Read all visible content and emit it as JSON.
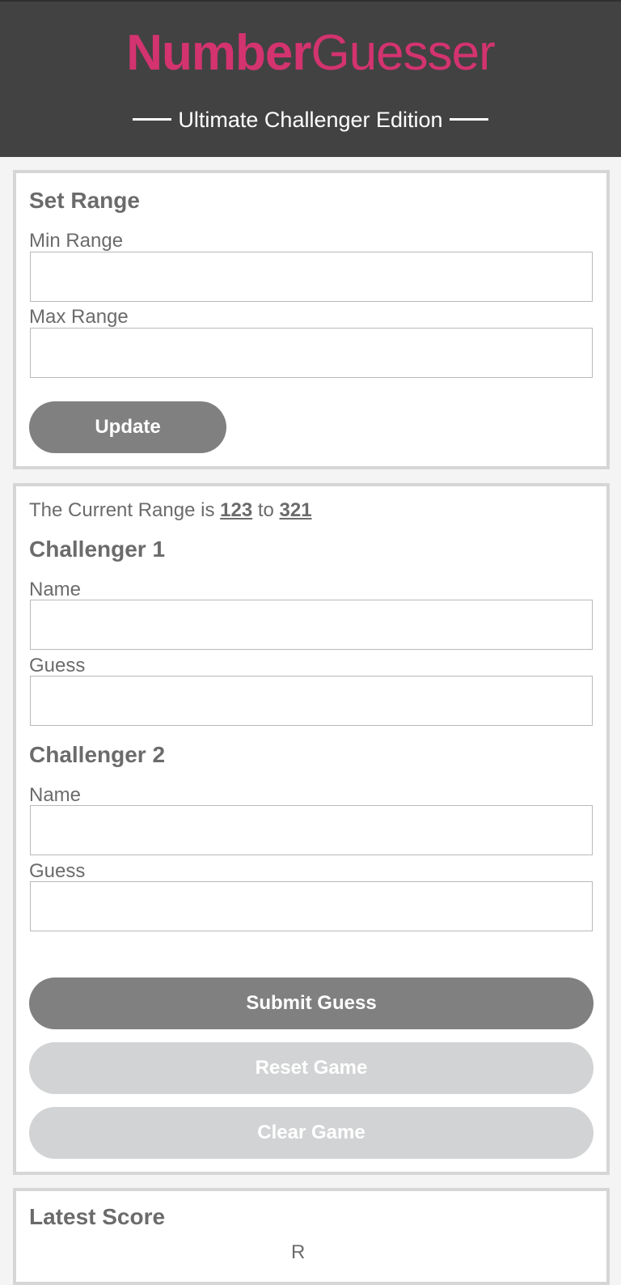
{
  "header": {
    "logo_bold": "Number",
    "logo_light": "Guesser",
    "subtitle": "Ultimate Challenger Edition"
  },
  "set_range": {
    "title": "Set Range",
    "min_label": "Min Range",
    "min_value": "",
    "max_label": "Max Range",
    "max_value": "",
    "update_button": "Update"
  },
  "challenge": {
    "range_prefix": "The Current Range is",
    "range_min": "123",
    "range_joiner": "to",
    "range_max": "321",
    "challenger1": {
      "title": "Challenger 1",
      "name_label": "Name",
      "name_value": "",
      "guess_label": "Guess",
      "guess_value": ""
    },
    "challenger2": {
      "title": "Challenger 2",
      "name_label": "Name",
      "name_value": "",
      "guess_label": "Guess",
      "guess_value": ""
    },
    "submit_button": "Submit Guess",
    "reset_button": "Reset Game",
    "clear_button": "Clear Game"
  },
  "score": {
    "title": "Latest Score",
    "partial_text": "R"
  },
  "colors": {
    "header_bg": "#424242",
    "logo": "#d3336f",
    "button_dark": "#808080",
    "button_disabled": "#d2d3d4",
    "card_border": "#d6d6d6"
  }
}
